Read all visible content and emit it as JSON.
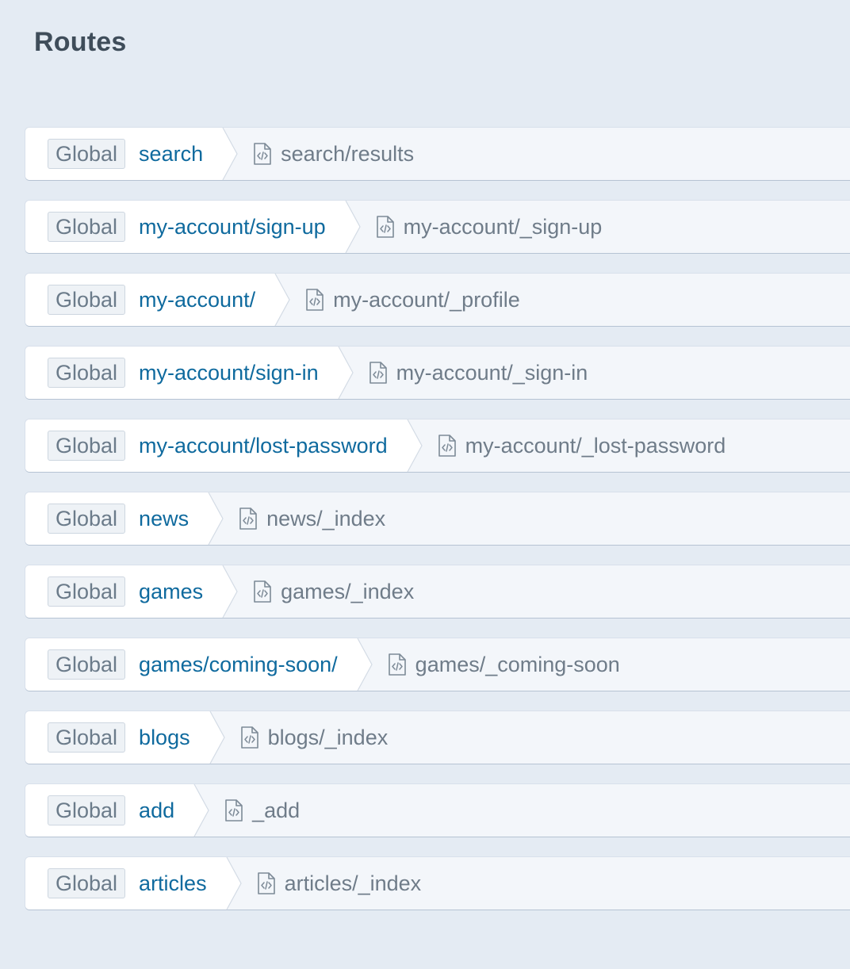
{
  "page": {
    "title": "Routes"
  },
  "routes": [
    {
      "site": "Global",
      "uri": "search",
      "template": "search/results"
    },
    {
      "site": "Global",
      "uri": "my-account/sign-up",
      "template": "my-account/_sign-up"
    },
    {
      "site": "Global",
      "uri": "my-account/",
      "template": "my-account/_profile"
    },
    {
      "site": "Global",
      "uri": "my-account/sign-in",
      "template": "my-account/_sign-in"
    },
    {
      "site": "Global",
      "uri": "my-account/lost-password",
      "template": "my-account/_lost-password"
    },
    {
      "site": "Global",
      "uri": "news",
      "template": "news/_index"
    },
    {
      "site": "Global",
      "uri": "games",
      "template": "games/_index"
    },
    {
      "site": "Global",
      "uri": "games/coming-soon/",
      "template": "games/_coming-soon"
    },
    {
      "site": "Global",
      "uri": "blogs",
      "template": "blogs/_index"
    },
    {
      "site": "Global",
      "uri": "add",
      "template": "_add"
    },
    {
      "site": "Global",
      "uri": "articles",
      "template": "articles/_index"
    }
  ],
  "icons": {
    "template": "code-file-icon"
  },
  "colors": {
    "background": "#e4ebf3",
    "uri_text": "#0f6a9e",
    "template_text": "#6f7c89",
    "badge_bg": "#eef2f6"
  }
}
